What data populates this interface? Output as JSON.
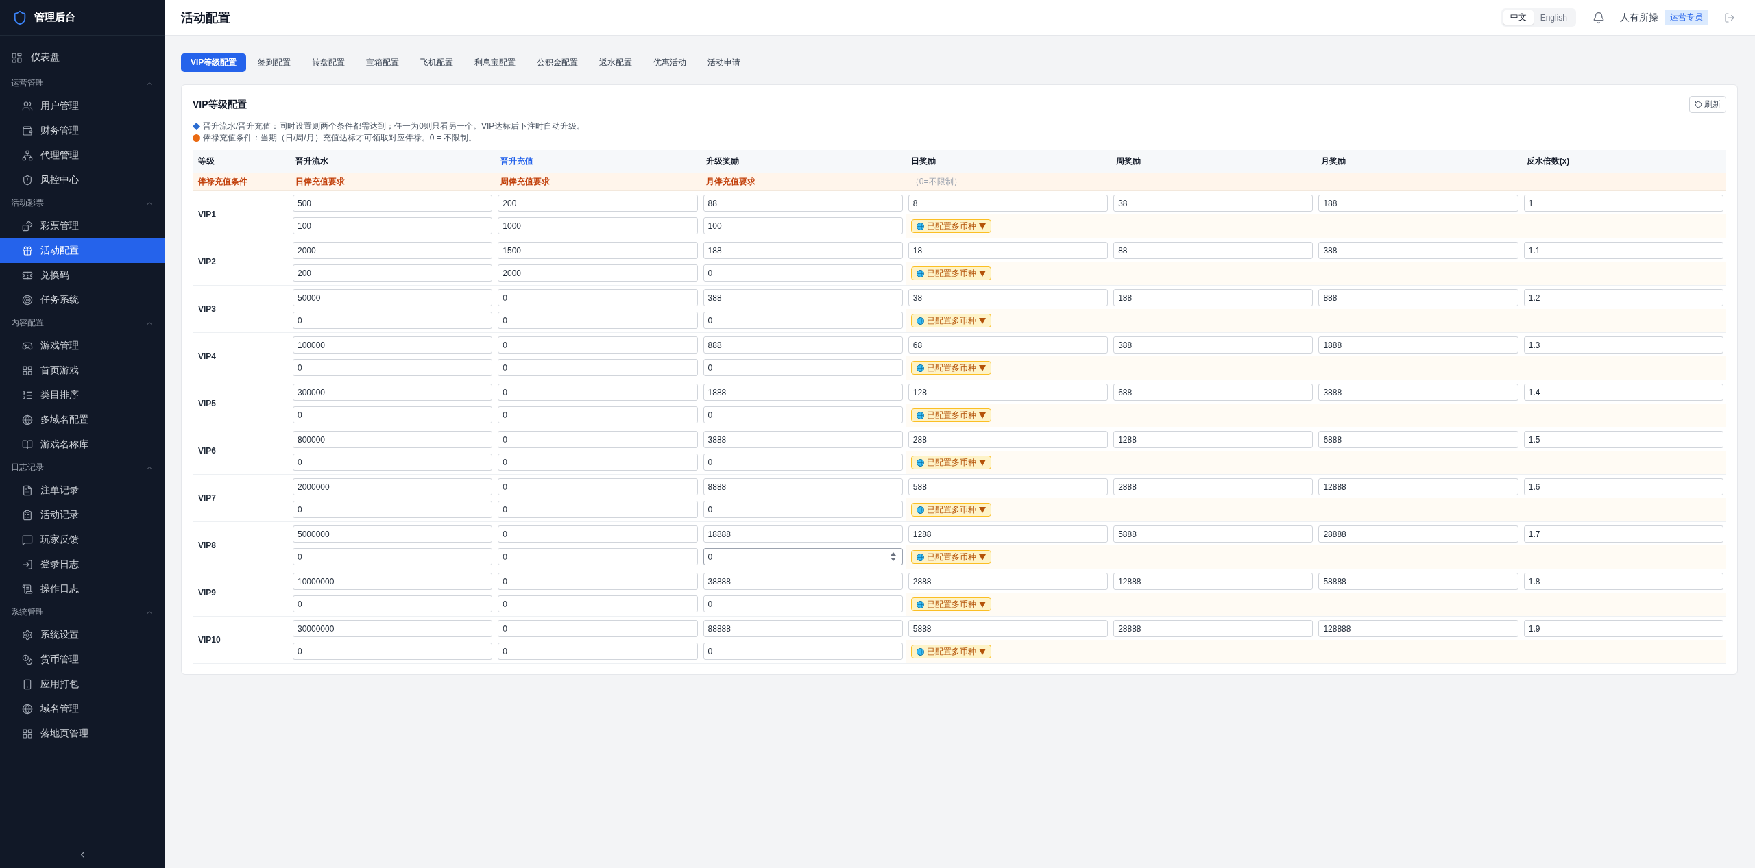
{
  "sidebar": {
    "title": "管理后台",
    "items": [
      {
        "label": "仪表盘",
        "selected": false
      }
    ],
    "sections": [
      {
        "label": "运营管理",
        "expanded": true,
        "items": [
          {
            "label": "用户管理",
            "selected": false
          },
          {
            "label": "财务管理",
            "selected": false
          },
          {
            "label": "代理管理",
            "selected": false
          },
          {
            "label": "风控中心",
            "selected": false
          }
        ]
      },
      {
        "label": "活动彩票",
        "expanded": true,
        "items": [
          {
            "label": "彩票管理",
            "selected": false
          },
          {
            "label": "活动配置",
            "selected": true
          },
          {
            "label": "兑换码",
            "selected": false
          },
          {
            "label": "任务系统",
            "selected": false
          }
        ]
      },
      {
        "label": "内容配置",
        "expanded": true,
        "items": [
          {
            "label": "游戏管理",
            "selected": false
          },
          {
            "label": "首页游戏",
            "selected": false
          },
          {
            "label": "类目排序",
            "selected": false
          },
          {
            "label": "多域名配置",
            "selected": false
          },
          {
            "label": "游戏名称库",
            "selected": false
          }
        ]
      },
      {
        "label": "日志记录",
        "expanded": true,
        "items": [
          {
            "label": "注单记录",
            "selected": false
          },
          {
            "label": "活动记录",
            "selected": false
          },
          {
            "label": "玩家反馈",
            "selected": false
          },
          {
            "label": "登录日志",
            "selected": false
          },
          {
            "label": "操作日志",
            "selected": false
          }
        ]
      },
      {
        "label": "系统管理",
        "expanded": true,
        "items": [
          {
            "label": "系统设置",
            "selected": false
          },
          {
            "label": "货币管理",
            "selected": false
          },
          {
            "label": "应用打包",
            "selected": false
          },
          {
            "label": "域名管理",
            "selected": false
          },
          {
            "label": "落地页管理",
            "selected": false
          }
        ]
      }
    ]
  },
  "header": {
    "title": "活动配置",
    "languages": [
      {
        "label": "中文",
        "selected": true
      },
      {
        "label": "English",
        "selected": false
      }
    ],
    "user": "人有所操",
    "role": "运营专员"
  },
  "tabs": [
    {
      "label": "VIP等级配置",
      "selected": true
    },
    {
      "label": "签到配置",
      "selected": false
    },
    {
      "label": "转盘配置",
      "selected": false
    },
    {
      "label": "宝箱配置",
      "selected": false
    },
    {
      "label": "飞机配置",
      "selected": false
    },
    {
      "label": "利息宝配置",
      "selected": false
    },
    {
      "label": "公积金配置",
      "selected": false
    },
    {
      "label": "返水配置",
      "selected": false
    },
    {
      "label": "优惠活动",
      "selected": false
    },
    {
      "label": "活动申请",
      "selected": false
    }
  ],
  "panel": {
    "title": "VIP等级配置",
    "refresh": "刷新",
    "notes": [
      {
        "kind": "diamond",
        "text": "晋升流水/晋升充值：同时设置则两个条件都需达到；任一为0则只看另一个。VIP达标后下注时自动升级。"
      },
      {
        "kind": "circle",
        "text": "俸禄充值条件：当期（日/周/月）充值达标才可领取对应俸禄。0 = 不限制。"
      }
    ],
    "columns": [
      {
        "label": "等级",
        "highlighted": false
      },
      {
        "label": "晋升流水",
        "highlighted": false
      },
      {
        "label": "晋升充值",
        "highlighted": true
      },
      {
        "label": "升级奖励",
        "highlighted": false
      },
      {
        "label": "日奖励",
        "highlighted": false
      },
      {
        "label": "周奖励",
        "highlighted": false
      },
      {
        "label": "月奖励",
        "highlighted": false
      },
      {
        "label": "反水倍数(x)",
        "highlighted": false
      }
    ],
    "condition_columns": [
      {
        "label": "俸禄充值条件",
        "kind": "label"
      },
      {
        "label": "日俸充值要求",
        "kind": "label"
      },
      {
        "label": "周俸充值要求",
        "kind": "label"
      },
      {
        "label": "月俸充值要求",
        "kind": "label"
      },
      {
        "label": "（0=不限制）",
        "kind": "hint"
      }
    ],
    "rows": [
      {
        "level": "VIP1",
        "values": [
          "500",
          "200",
          "88",
          "8",
          "38",
          "188",
          "1"
        ],
        "requirements": [
          {
            "value": "100",
            "hovered": false
          },
          {
            "value": "1000",
            "hovered": false
          },
          {
            "value": "100",
            "hovered": false
          }
        ],
        "currency": "已配置多币种"
      },
      {
        "level": "VIP2",
        "values": [
          "2000",
          "1500",
          "188",
          "18",
          "88",
          "388",
          "1.1"
        ],
        "requirements": [
          {
            "value": "200",
            "hovered": false
          },
          {
            "value": "2000",
            "hovered": false
          },
          {
            "value": "0",
            "hovered": false
          }
        ],
        "currency": "已配置多币种"
      },
      {
        "level": "VIP3",
        "values": [
          "50000",
          "0",
          "388",
          "38",
          "188",
          "888",
          "1.2"
        ],
        "requirements": [
          {
            "value": "0",
            "hovered": false
          },
          {
            "value": "0",
            "hovered": false
          },
          {
            "value": "0",
            "hovered": false
          }
        ],
        "currency": "已配置多币种"
      },
      {
        "level": "VIP4",
        "values": [
          "100000",
          "0",
          "888",
          "68",
          "388",
          "1888",
          "1.3"
        ],
        "requirements": [
          {
            "value": "0",
            "hovered": false
          },
          {
            "value": "0",
            "hovered": false
          },
          {
            "value": "0",
            "hovered": false
          }
        ],
        "currency": "已配置多币种"
      },
      {
        "level": "VIP5",
        "values": [
          "300000",
          "0",
          "1888",
          "128",
          "688",
          "3888",
          "1.4"
        ],
        "requirements": [
          {
            "value": "0",
            "hovered": false
          },
          {
            "value": "0",
            "hovered": false
          },
          {
            "value": "0",
            "hovered": false
          }
        ],
        "currency": "已配置多币种"
      },
      {
        "level": "VIP6",
        "values": [
          "800000",
          "0",
          "3888",
          "288",
          "1288",
          "6888",
          "1.5"
        ],
        "requirements": [
          {
            "value": "0",
            "hovered": false
          },
          {
            "value": "0",
            "hovered": false
          },
          {
            "value": "0",
            "hovered": false
          }
        ],
        "currency": "已配置多币种"
      },
      {
        "level": "VIP7",
        "values": [
          "2000000",
          "0",
          "8888",
          "588",
          "2888",
          "12888",
          "1.6"
        ],
        "requirements": [
          {
            "value": "0",
            "hovered": false
          },
          {
            "value": "0",
            "hovered": false
          },
          {
            "value": "0",
            "hovered": false
          }
        ],
        "currency": "已配置多币种"
      },
      {
        "level": "VIP8",
        "values": [
          "5000000",
          "0",
          "18888",
          "1288",
          "5888",
          "28888",
          "1.7"
        ],
        "requirements": [
          {
            "value": "0",
            "hovered": false
          },
          {
            "value": "0",
            "hovered": false
          },
          {
            "value": "0",
            "hovered": true
          }
        ],
        "currency": "已配置多币种"
      },
      {
        "level": "VIP9",
        "values": [
          "10000000",
          "0",
          "38888",
          "2888",
          "12888",
          "58888",
          "1.8"
        ],
        "requirements": [
          {
            "value": "0",
            "hovered": false
          },
          {
            "value": "0",
            "hovered": false
          },
          {
            "value": "0",
            "hovered": false
          }
        ],
        "currency": "已配置多币种"
      },
      {
        "level": "VIP10",
        "values": [
          "30000000",
          "0",
          "88888",
          "5888",
          "28888",
          "128888",
          "1.9"
        ],
        "requirements": [
          {
            "value": "0",
            "hovered": false
          },
          {
            "value": "0",
            "hovered": false
          },
          {
            "value": "0",
            "hovered": false
          }
        ],
        "currency": "已配置多币种"
      }
    ]
  }
}
